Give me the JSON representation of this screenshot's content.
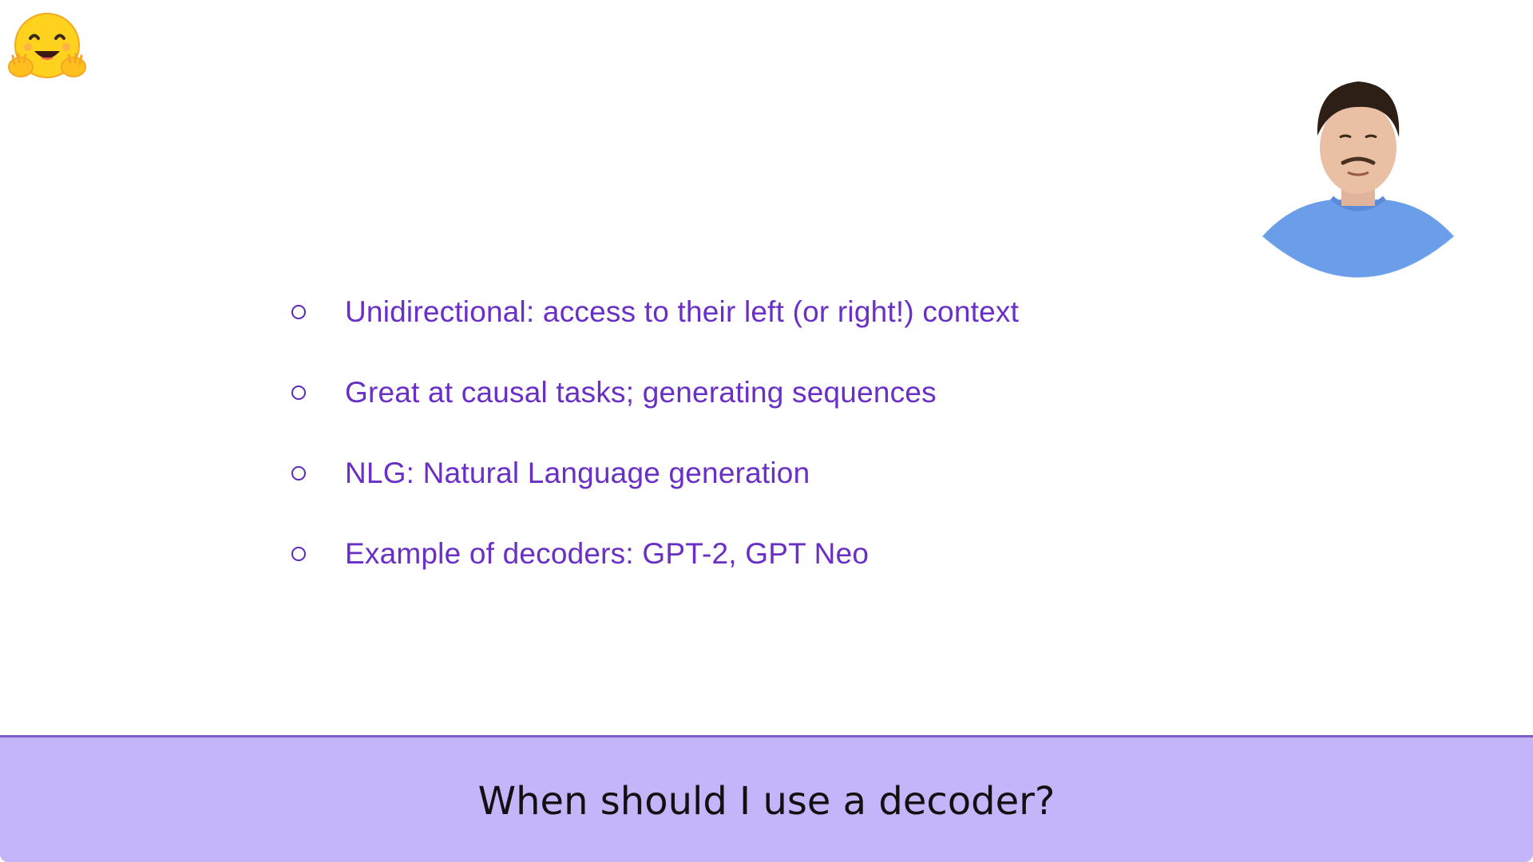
{
  "logo": {
    "icon": "hugging-face-emoji-icon"
  },
  "presenter": {
    "icon": "presenter-webcam-icon"
  },
  "bullets": [
    {
      "text": "Unidirectional: access to their left (or right!) context"
    },
    {
      "text": "Great at causal tasks; generating sequences"
    },
    {
      "text": "NLG: Natural Language generation"
    },
    {
      "text": "Example of decoders: GPT-2, GPT Neo"
    }
  ],
  "caption": {
    "text": "When should I use a decoder?"
  },
  "colors": {
    "bullet_text": "#6a2fc4",
    "caption_background": "#c4b5fb",
    "caption_border": "#7c5cc6"
  }
}
